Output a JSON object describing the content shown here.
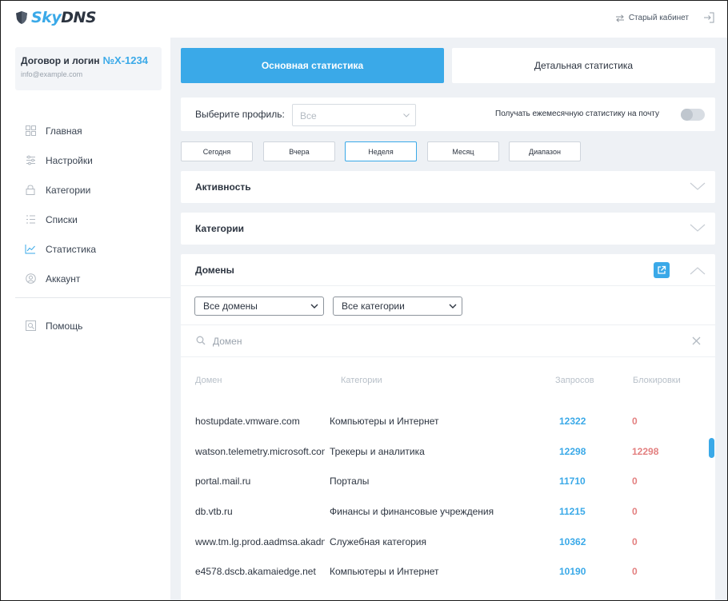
{
  "brand": {
    "logo_sky": "Sky",
    "logo_dns": "DNS",
    "accent": "#3aa9e8"
  },
  "header": {
    "old_cabinet_label": "Старый кабинет",
    "old_cabinet_icon": "swap-arrows-icon",
    "logout_icon": "logout-icon"
  },
  "account": {
    "title": "Договор и логин",
    "number": "№X-1234",
    "email": "info@example.com"
  },
  "sidebar": {
    "items": [
      {
        "label": "Главная",
        "icon": "dashboard-grid-icon"
      },
      {
        "label": "Настройки",
        "icon": "sliders-icon"
      },
      {
        "label": "Категории",
        "icon": "lock-icon"
      },
      {
        "label": "Списки",
        "icon": "list-icon"
      },
      {
        "label": "Статистика",
        "icon": "chart-line-icon"
      },
      {
        "label": "Аккаунт",
        "icon": "user-circle-icon"
      }
    ],
    "help_label": "Помощь",
    "help_icon": "help-search-icon"
  },
  "tabs": {
    "main": "Основная статистика",
    "detail": "Детальная статистика"
  },
  "profile": {
    "label": "Выберите профиль:",
    "selected": "Все",
    "monthly_label": "Получать ежемесячную статистику на почту",
    "monthly_enabled": false
  },
  "periods": {
    "buttons": [
      "Сегодня",
      "Вчера",
      "Неделя",
      "Месяц",
      "Диапазон"
    ],
    "active": "Неделя"
  },
  "sections": {
    "activity": "Активность",
    "categories": "Категории",
    "domains": "Домены"
  },
  "domains": {
    "filter_domains": "Все домены",
    "filter_categories": "Все категории",
    "search_placeholder": "Домен",
    "columns": {
      "domain": "Домен",
      "category": "Категории",
      "requests": "Запросов",
      "blocks": "Блокировки"
    },
    "rows": [
      {
        "domain": "hostupdate.vmware.com",
        "category": "Компьютеры и Интернет",
        "requests": "12322",
        "blocks": "0"
      },
      {
        "domain": "watson.telemetry.microsoft.com",
        "category": "Трекеры и аналитика",
        "requests": "12298",
        "blocks": "12298"
      },
      {
        "domain": "portal.mail.ru",
        "category": "Порталы",
        "requests": "11710",
        "blocks": "0"
      },
      {
        "domain": "db.vtb.ru",
        "category": "Финансы и финансовые учреждения",
        "requests": "11215",
        "blocks": "0"
      },
      {
        "domain": "www.tm.lg.prod.aadmsa.akadns.net",
        "category": "Служебная категория",
        "requests": "10362",
        "blocks": "0"
      },
      {
        "domain": "e4578.dscb.akamaiedge.net",
        "category": "Компьютеры и Интернет",
        "requests": "10190",
        "blocks": "0"
      }
    ]
  }
}
